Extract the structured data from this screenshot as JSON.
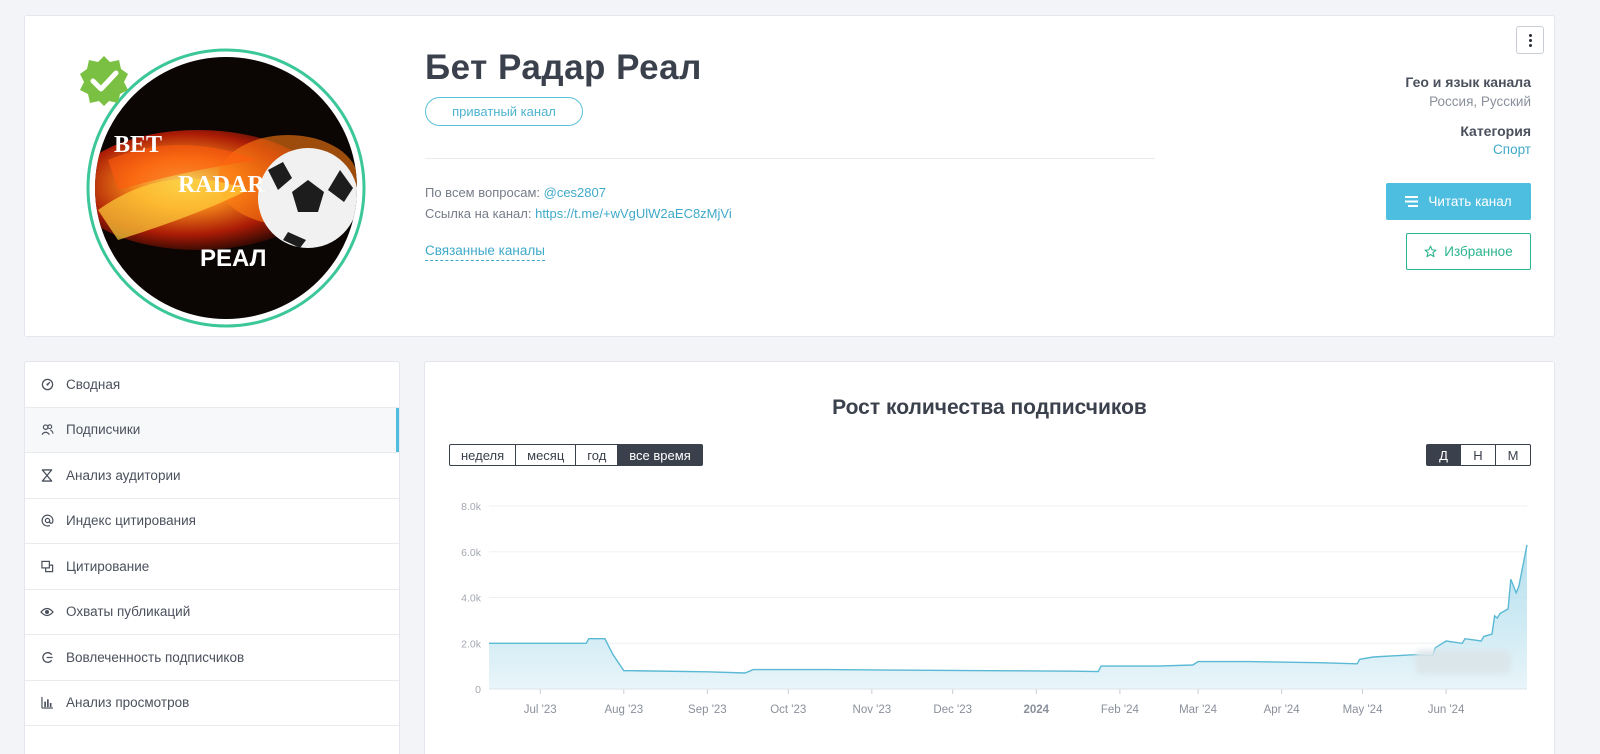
{
  "channel": {
    "title": "Бет Радар Реал",
    "badge": "приватный канал",
    "questions_label": "По всем вопросам:",
    "questions_contact": "@ces2807",
    "link_label": "Ссылка на канал:",
    "link_url": "https://t.me/+wVgUlW2aEC8zMjVi",
    "related_channels": "Связанные каналы",
    "avatar_text": [
      "BET",
      "RADAR",
      "РЕАЛ"
    ]
  },
  "meta": {
    "geo_label": "Гео и язык канала",
    "geo_value": "Россия, Русский",
    "category_label": "Категория",
    "category_value": "Спорт",
    "read_button": "Читать канал",
    "favorite_button": "Избранное"
  },
  "sidebar": {
    "items": [
      {
        "label": "Сводная",
        "icon": "dashboard-icon"
      },
      {
        "label": "Подписчики",
        "icon": "users-icon",
        "active": true
      },
      {
        "label": "Анализ аудитории",
        "icon": "hourglass-icon"
      },
      {
        "label": "Индекс цитирования",
        "icon": "at-icon"
      },
      {
        "label": "Цитирование",
        "icon": "quote-icon"
      },
      {
        "label": "Охваты публикаций",
        "icon": "eye-icon"
      },
      {
        "label": "Вовлеченность подписчиков",
        "icon": "engagement-icon"
      },
      {
        "label": "Анализ просмотров",
        "icon": "bar-chart-icon"
      }
    ]
  },
  "chart_card": {
    "title": "Рост количества подписчиков",
    "ranges": [
      "неделя",
      "месяц",
      "год",
      "все время"
    ],
    "active_range": "все время",
    "granularity": [
      "Д",
      "Н",
      "М"
    ],
    "active_granularity": "Д"
  },
  "colors": {
    "accent": "#4dbde0",
    "favorite": "#2bb58e",
    "verified": "#7ac143",
    "avatar_ring": "#3cc79a",
    "line": "#5ab9d4"
  },
  "chart_data": {
    "type": "area",
    "title": "Рост количества подписчиков",
    "xlabel": "",
    "ylabel": "",
    "ylim": [
      0,
      8000
    ],
    "y_ticks": [
      0,
      2000,
      4000,
      6000,
      8000
    ],
    "y_tick_labels": [
      "0",
      "2.0k",
      "4.0k",
      "6.0k",
      "8.0k"
    ],
    "x_tick_labels": [
      "Jul '23",
      "Aug '23",
      "Sep '23",
      "Oct '23",
      "Nov '23",
      "Dec '23",
      "2024",
      "Feb '24",
      "Mar '24",
      "Apr '24",
      "May '24",
      "Jun '24"
    ],
    "grid": true,
    "series": [
      {
        "x": [
          "2023-06-12",
          "2023-07-18",
          "2023-07-19",
          "2023-07-25",
          "2023-07-28",
          "2023-08-01",
          "2023-08-04",
          "2023-09-01",
          "2023-09-15",
          "2023-09-18",
          "2023-10-15",
          "2023-11-15",
          "2023-12-15",
          "2024-01-15",
          "2024-01-24",
          "2024-01-25",
          "2024-02-15",
          "2024-02-28",
          "2024-03-01",
          "2024-03-20",
          "2024-04-15",
          "2024-04-29",
          "2024-04-30",
          "2024-05-05",
          "2024-05-20",
          "2024-05-27",
          "2024-05-28",
          "2024-06-01",
          "2024-06-07",
          "2024-06-08",
          "2024-06-14",
          "2024-06-15",
          "2024-06-18",
          "2024-06-19",
          "2024-06-20",
          "2024-06-21",
          "2024-06-24",
          "2024-06-25",
          "2024-06-27",
          "2024-06-28",
          "2024-07-01"
        ],
        "y": [
          2000,
          2000,
          2200,
          2200,
          1500,
          800,
          800,
          750,
          700,
          850,
          850,
          820,
          800,
          780,
          760,
          1000,
          1000,
          1050,
          1200,
          1200,
          1150,
          1100,
          1300,
          1400,
          1500,
          1450,
          1800,
          2100,
          2000,
          2200,
          2100,
          2300,
          2400,
          3200,
          3100,
          3300,
          3500,
          4800,
          4200,
          4500,
          6300
        ]
      }
    ]
  }
}
